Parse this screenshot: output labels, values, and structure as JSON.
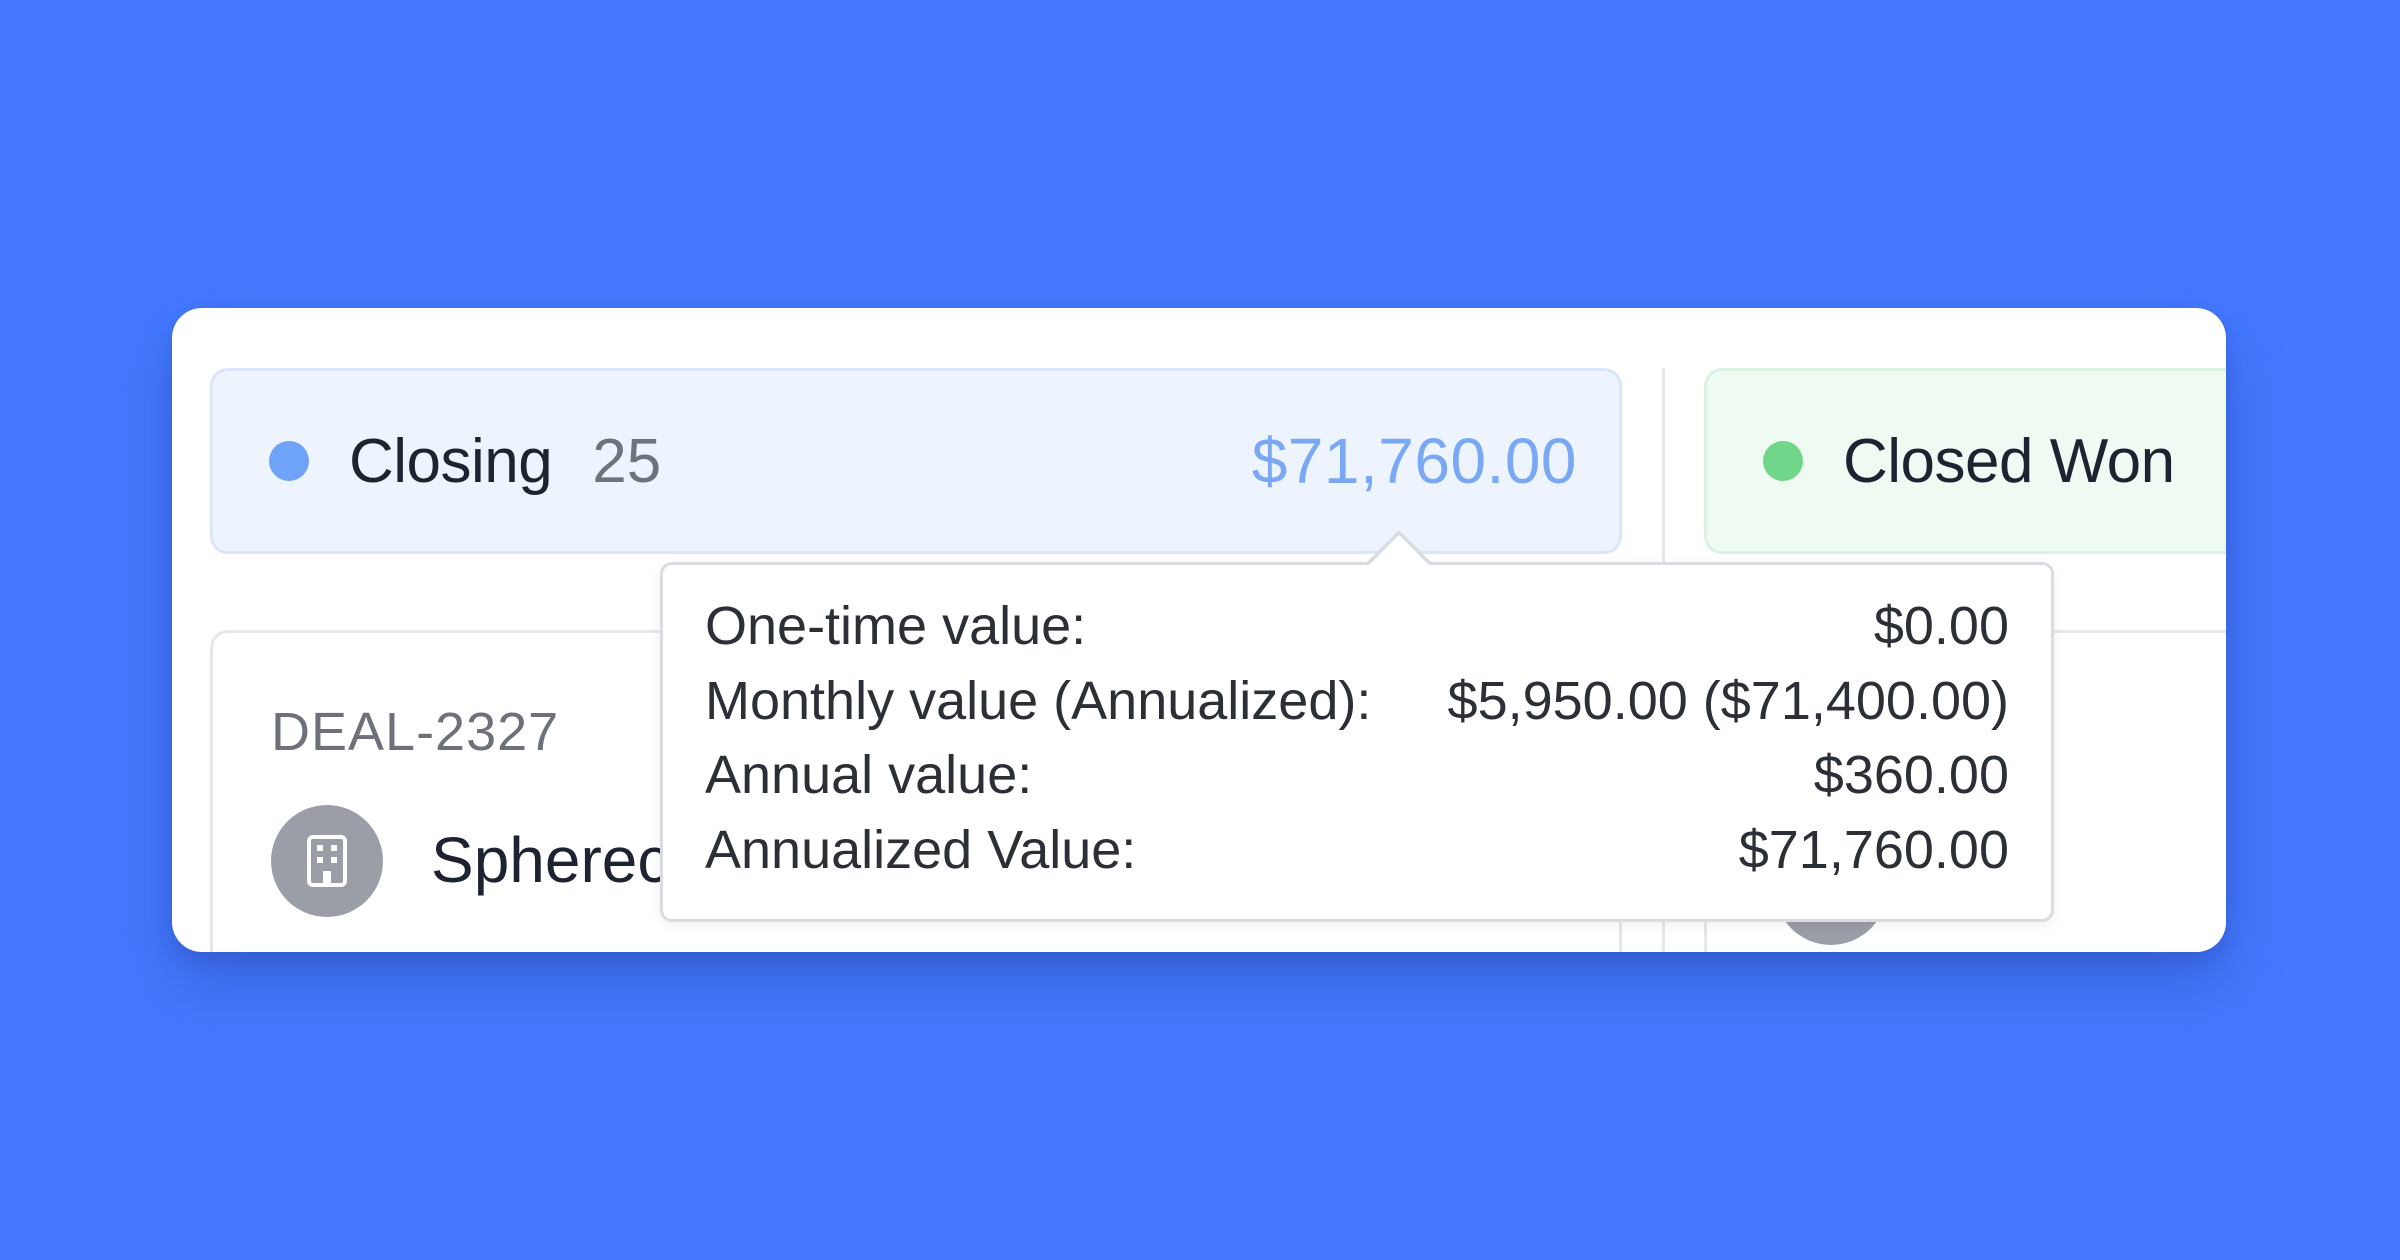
{
  "columns": [
    {
      "name": "Closing",
      "count": "25",
      "total": "$71,760.00",
      "dot_color": "#6fa3f7"
    },
    {
      "name": "Closed Won",
      "dot_color": "#6fd68a"
    }
  ],
  "deal": {
    "id": "DEAL-2327",
    "company": "Spherec",
    "avatar_icon": "building-icon"
  },
  "tooltip": {
    "rows": [
      {
        "label": "One-time value:",
        "value": "$0.00"
      },
      {
        "label": "Monthly value (Annualized):",
        "value": "$5,950.00 ($71,400.00)"
      },
      {
        "label": "Annual value:",
        "value": "$360.00"
      },
      {
        "label": "Annualized Value:",
        "value": "$71,760.00"
      }
    ]
  }
}
